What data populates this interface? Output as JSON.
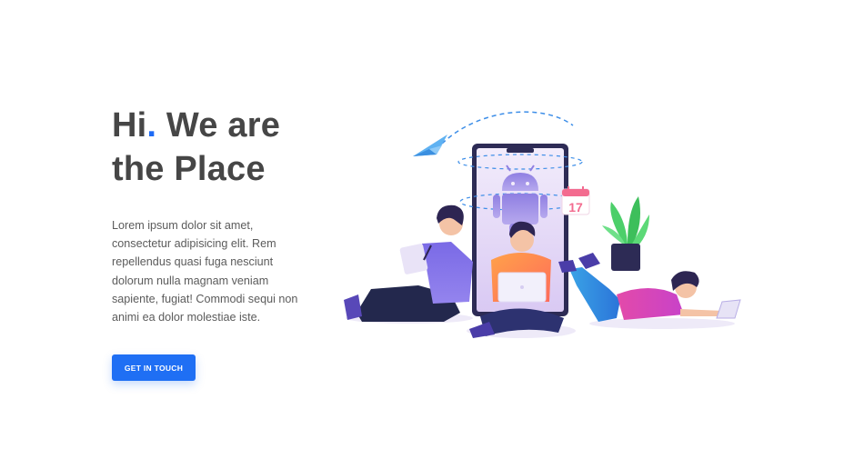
{
  "hero": {
    "title_hi": "Hi",
    "title_dot": ".",
    "title_rest": " We are",
    "title_line2": "the Place",
    "description": "Lorem ipsum dolor sit amet, consectetur adipisicing elit. Rem repellendus quasi fuga nesciunt dolorum nulla magnam veniam sapiente, fugiat! Commodi sequi non animi ea dolor molestiae iste.",
    "cta_label": "GET IN TOUCH"
  },
  "illustration": {
    "calendar_day": "17",
    "icons": [
      "paper-plane-icon",
      "android-robot-icon",
      "calendar-icon",
      "potted-plant-icon",
      "laptop-icon"
    ]
  },
  "colors": {
    "accent": "#1f6ff4",
    "title_text": "#464646",
    "body_text": "#5b5b5b",
    "background": "#ffffff"
  }
}
